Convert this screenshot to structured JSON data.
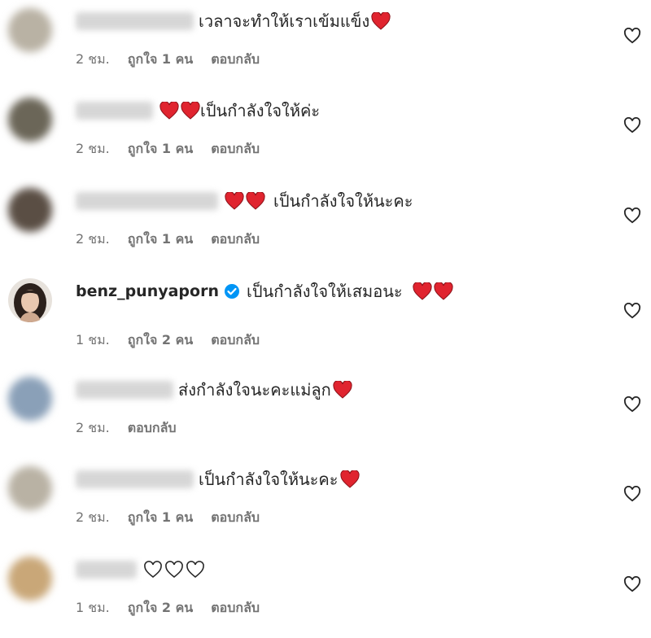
{
  "comments": [
    {
      "text": "เวลาจะทำให้เราเข้มแข็ง",
      "time": "2 ชม.",
      "likes": "ถูกใจ 1 คน",
      "reply": "ตอบกลับ"
    },
    {
      "text": "เป็นกำลังใจให้ค่ะ",
      "time": "2 ชม.",
      "likes": "ถูกใจ 1 คน",
      "reply": "ตอบกลับ"
    },
    {
      "text": "เป็นกำลังใจให้นะคะ",
      "time": "2 ชม.",
      "likes": "ถูกใจ 1 คน",
      "reply": "ตอบกลับ"
    },
    {
      "username": "benz_punyaporn",
      "text": "เป็นกำลังใจให้เสมอนะ",
      "time": "1 ชม.",
      "likes": "ถูกใจ 2 คน",
      "reply": "ตอบกลับ"
    },
    {
      "text": "ส่งกำลังใจนะคะแม่ลูก",
      "time": "2 ชม.",
      "reply": "ตอบกลับ"
    },
    {
      "text": "เป็นกำลังใจให้นะคะ",
      "time": "2 ชม.",
      "likes": "ถูกใจ 1 คน",
      "reply": "ตอบกลับ"
    },
    {
      "text": "",
      "time": "1 ชม.",
      "likes": "ถูกใจ 2 คน",
      "reply": "ตอบกลับ"
    }
  ],
  "colors": {
    "heart_red": "#e0242f",
    "verified_blue": "#0095f6",
    "meta_gray": "#737373"
  },
  "icons": {
    "like": "heart-outline-icon",
    "emoji": "red-heart-emoji",
    "verified": "verified-badge-icon"
  }
}
